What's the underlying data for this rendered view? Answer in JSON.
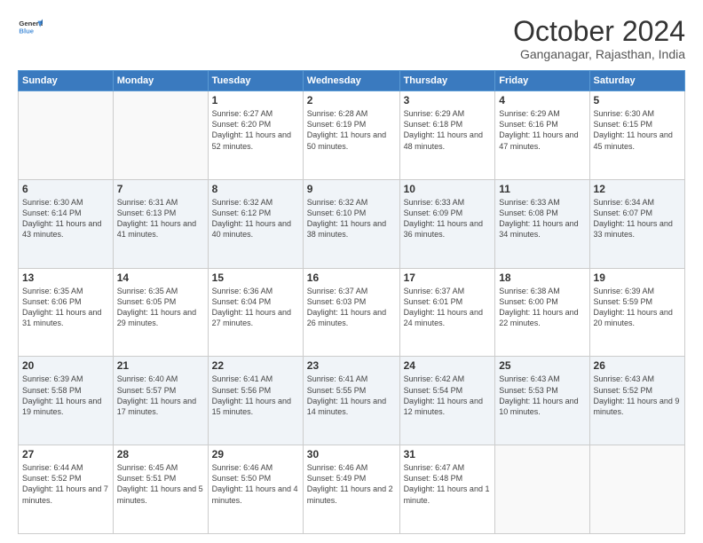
{
  "logo": {
    "line1": "General",
    "line2": "Blue"
  },
  "title": "October 2024",
  "subtitle": "Ganganagar, Rajasthan, India",
  "headers": [
    "Sunday",
    "Monday",
    "Tuesday",
    "Wednesday",
    "Thursday",
    "Friday",
    "Saturday"
  ],
  "weeks": [
    [
      {
        "day": "",
        "sunrise": "",
        "sunset": "",
        "daylight": "",
        "empty": true
      },
      {
        "day": "",
        "sunrise": "",
        "sunset": "",
        "daylight": "",
        "empty": true
      },
      {
        "day": "1",
        "sunrise": "Sunrise: 6:27 AM",
        "sunset": "Sunset: 6:20 PM",
        "daylight": "Daylight: 11 hours and 52 minutes."
      },
      {
        "day": "2",
        "sunrise": "Sunrise: 6:28 AM",
        "sunset": "Sunset: 6:19 PM",
        "daylight": "Daylight: 11 hours and 50 minutes."
      },
      {
        "day": "3",
        "sunrise": "Sunrise: 6:29 AM",
        "sunset": "Sunset: 6:18 PM",
        "daylight": "Daylight: 11 hours and 48 minutes."
      },
      {
        "day": "4",
        "sunrise": "Sunrise: 6:29 AM",
        "sunset": "Sunset: 6:16 PM",
        "daylight": "Daylight: 11 hours and 47 minutes."
      },
      {
        "day": "5",
        "sunrise": "Sunrise: 6:30 AM",
        "sunset": "Sunset: 6:15 PM",
        "daylight": "Daylight: 11 hours and 45 minutes."
      }
    ],
    [
      {
        "day": "6",
        "sunrise": "Sunrise: 6:30 AM",
        "sunset": "Sunset: 6:14 PM",
        "daylight": "Daylight: 11 hours and 43 minutes."
      },
      {
        "day": "7",
        "sunrise": "Sunrise: 6:31 AM",
        "sunset": "Sunset: 6:13 PM",
        "daylight": "Daylight: 11 hours and 41 minutes."
      },
      {
        "day": "8",
        "sunrise": "Sunrise: 6:32 AM",
        "sunset": "Sunset: 6:12 PM",
        "daylight": "Daylight: 11 hours and 40 minutes."
      },
      {
        "day": "9",
        "sunrise": "Sunrise: 6:32 AM",
        "sunset": "Sunset: 6:10 PM",
        "daylight": "Daylight: 11 hours and 38 minutes."
      },
      {
        "day": "10",
        "sunrise": "Sunrise: 6:33 AM",
        "sunset": "Sunset: 6:09 PM",
        "daylight": "Daylight: 11 hours and 36 minutes."
      },
      {
        "day": "11",
        "sunrise": "Sunrise: 6:33 AM",
        "sunset": "Sunset: 6:08 PM",
        "daylight": "Daylight: 11 hours and 34 minutes."
      },
      {
        "day": "12",
        "sunrise": "Sunrise: 6:34 AM",
        "sunset": "Sunset: 6:07 PM",
        "daylight": "Daylight: 11 hours and 33 minutes."
      }
    ],
    [
      {
        "day": "13",
        "sunrise": "Sunrise: 6:35 AM",
        "sunset": "Sunset: 6:06 PM",
        "daylight": "Daylight: 11 hours and 31 minutes."
      },
      {
        "day": "14",
        "sunrise": "Sunrise: 6:35 AM",
        "sunset": "Sunset: 6:05 PM",
        "daylight": "Daylight: 11 hours and 29 minutes."
      },
      {
        "day": "15",
        "sunrise": "Sunrise: 6:36 AM",
        "sunset": "Sunset: 6:04 PM",
        "daylight": "Daylight: 11 hours and 27 minutes."
      },
      {
        "day": "16",
        "sunrise": "Sunrise: 6:37 AM",
        "sunset": "Sunset: 6:03 PM",
        "daylight": "Daylight: 11 hours and 26 minutes."
      },
      {
        "day": "17",
        "sunrise": "Sunrise: 6:37 AM",
        "sunset": "Sunset: 6:01 PM",
        "daylight": "Daylight: 11 hours and 24 minutes."
      },
      {
        "day": "18",
        "sunrise": "Sunrise: 6:38 AM",
        "sunset": "Sunset: 6:00 PM",
        "daylight": "Daylight: 11 hours and 22 minutes."
      },
      {
        "day": "19",
        "sunrise": "Sunrise: 6:39 AM",
        "sunset": "Sunset: 5:59 PM",
        "daylight": "Daylight: 11 hours and 20 minutes."
      }
    ],
    [
      {
        "day": "20",
        "sunrise": "Sunrise: 6:39 AM",
        "sunset": "Sunset: 5:58 PM",
        "daylight": "Daylight: 11 hours and 19 minutes."
      },
      {
        "day": "21",
        "sunrise": "Sunrise: 6:40 AM",
        "sunset": "Sunset: 5:57 PM",
        "daylight": "Daylight: 11 hours and 17 minutes."
      },
      {
        "day": "22",
        "sunrise": "Sunrise: 6:41 AM",
        "sunset": "Sunset: 5:56 PM",
        "daylight": "Daylight: 11 hours and 15 minutes."
      },
      {
        "day": "23",
        "sunrise": "Sunrise: 6:41 AM",
        "sunset": "Sunset: 5:55 PM",
        "daylight": "Daylight: 11 hours and 14 minutes."
      },
      {
        "day": "24",
        "sunrise": "Sunrise: 6:42 AM",
        "sunset": "Sunset: 5:54 PM",
        "daylight": "Daylight: 11 hours and 12 minutes."
      },
      {
        "day": "25",
        "sunrise": "Sunrise: 6:43 AM",
        "sunset": "Sunset: 5:53 PM",
        "daylight": "Daylight: 11 hours and 10 minutes."
      },
      {
        "day": "26",
        "sunrise": "Sunrise: 6:43 AM",
        "sunset": "Sunset: 5:52 PM",
        "daylight": "Daylight: 11 hours and 9 minutes."
      }
    ],
    [
      {
        "day": "27",
        "sunrise": "Sunrise: 6:44 AM",
        "sunset": "Sunset: 5:52 PM",
        "daylight": "Daylight: 11 hours and 7 minutes."
      },
      {
        "day": "28",
        "sunrise": "Sunrise: 6:45 AM",
        "sunset": "Sunset: 5:51 PM",
        "daylight": "Daylight: 11 hours and 5 minutes."
      },
      {
        "day": "29",
        "sunrise": "Sunrise: 6:46 AM",
        "sunset": "Sunset: 5:50 PM",
        "daylight": "Daylight: 11 hours and 4 minutes."
      },
      {
        "day": "30",
        "sunrise": "Sunrise: 6:46 AM",
        "sunset": "Sunset: 5:49 PM",
        "daylight": "Daylight: 11 hours and 2 minutes."
      },
      {
        "day": "31",
        "sunrise": "Sunrise: 6:47 AM",
        "sunset": "Sunset: 5:48 PM",
        "daylight": "Daylight: 11 hours and 1 minute."
      },
      {
        "day": "",
        "sunrise": "",
        "sunset": "",
        "daylight": "",
        "empty": true
      },
      {
        "day": "",
        "sunrise": "",
        "sunset": "",
        "daylight": "",
        "empty": true
      }
    ]
  ]
}
